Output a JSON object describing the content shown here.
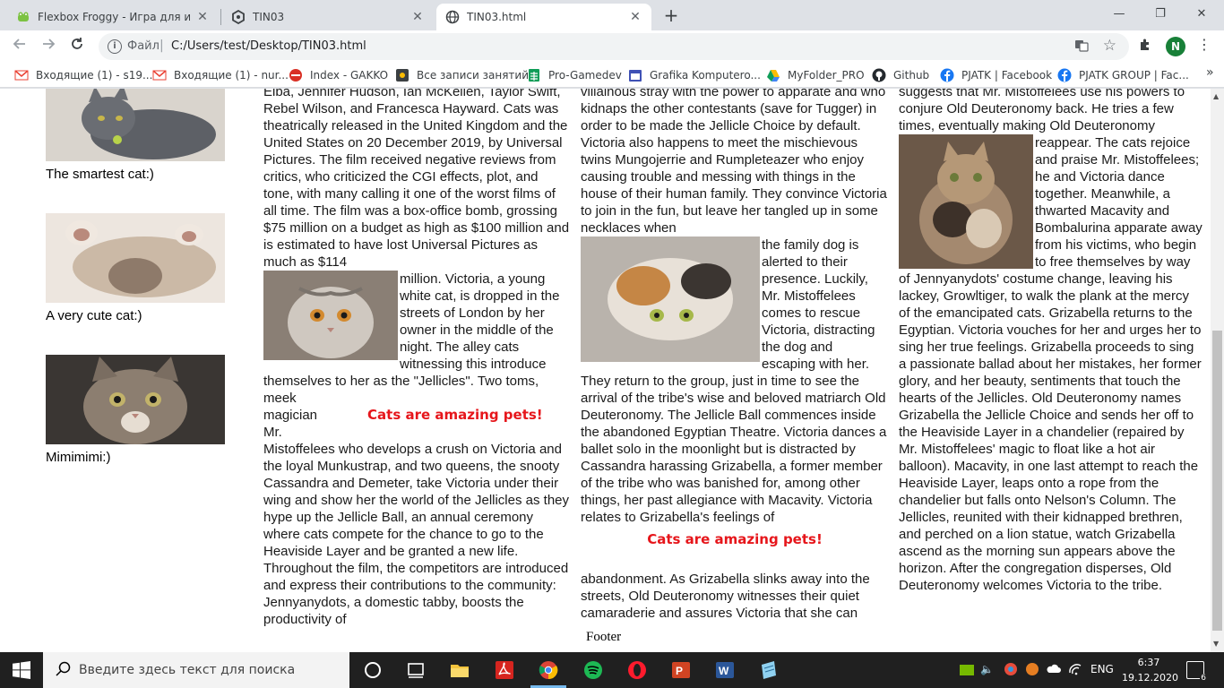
{
  "browser": {
    "tabs": [
      {
        "title": "Flexbox Froggy - Игра для изуче",
        "active": false
      },
      {
        "title": "TIN03",
        "active": false
      },
      {
        "title": "TIN03.html",
        "active": true
      }
    ],
    "omnibox": {
      "scheme_label": "Файл",
      "url": "C:/Users/test/Desktop/TIN03.html"
    },
    "profile_initial": "N",
    "bookmarks": [
      {
        "label": "Входящие (1) - s19...",
        "icon": "gmail-icon",
        "color": "#ea4335"
      },
      {
        "label": "Входящие (1) - nur...",
        "icon": "gmail-icon",
        "color": "#ea4335"
      },
      {
        "label": "Index - GAKKO",
        "icon": "gakko-icon",
        "color": "#d93025"
      },
      {
        "label": "Все записи занятий",
        "icon": "records-icon",
        "color": "#5f6368"
      },
      {
        "label": "Pro-Gamedev",
        "icon": "sheets-icon",
        "color": "#0f9d58"
      },
      {
        "label": "Grafika Komputero...",
        "icon": "calendar-icon",
        "color": "#3f51b5"
      },
      {
        "label": "MyFolder_PRO",
        "icon": "drive-icon",
        "color": "#fbbc04"
      },
      {
        "label": "Github",
        "icon": "github-icon",
        "color": "#24292e"
      },
      {
        "label": "PJATK | Facebook",
        "icon": "facebook-icon",
        "color": "#1877f2"
      },
      {
        "label": "PJATK GROUP | Fac...",
        "icon": "facebook-icon",
        "color": "#1877f2"
      }
    ]
  },
  "page": {
    "captions": [
      "The smartest cat:)",
      "A very cute cat:)",
      "Mimimimi:)"
    ],
    "pets_label": "Cats are amazing pets!",
    "footer": "Footer",
    "col1": {
      "p1": "Elba, Jennifer Hudson, Ian McKellen, Taylor Swift, Rebel Wilson, and Francesca Hayward. Cats was theatrically released in the United Kingdom and the United States on 20 December 2019, by Universal Pictures. The film received negative reviews from critics, who criticized the CGI effects, plot, and tone, with many calling it one of the worst films of all time. The film was a box-office bomb, grossing $75 million on a budget as high as $100 million and is estimated to have lost Universal Pictures as much as $114",
      "p2": "million. Victoria, a young white cat, is dropped in the streets of London by her owner in the middle of the night. The alley cats witnessing this introduce themselves to her as the \"Jellicles\". Two toms, meek",
      "p3a": "magician",
      "p3b": "Mr.",
      "p4": "Mistoffelees who develops a crush on Victoria and the loyal Munkustrap, and two queens, the snooty Cassandra and Demeter, take Victoria under their wing and show her the world of the Jellicles as they hype up the Jellicle Ball, an annual ceremony where cats compete for the chance to go to the Heaviside Layer and be granted a new life. Throughout the film, the competitors are introduced and express their contributions to the community: Jennyanydots, a domestic tabby, boosts the productivity of"
    },
    "col2": {
      "p1": "villainous stray with the power to apparate and who kidnaps the other contestants (save for Tugger) in order to be made the Jellicle Choice by default. Victoria also happens to meet the mischievous twins Mungojerrie and Rumpleteazer who enjoy causing trouble and messing with things in the house of their human family. They convince Victoria to join in the fun, but leave her tangled up in some necklaces when",
      "p2": "the family dog is alerted to their presence. Luckily, Mr. Mistoffelees comes to rescue Victoria, distracting the dog and escaping with her. They return to the group, just in time to see the arrival of the tribe's wise and beloved matriarch Old Deuteronomy. The Jellicle Ball commences inside the abandoned Egyptian Theatre. Victoria dances a ballet solo in the moonlight but is distracted by Cassandra harassing Grizabella, a former member of the tribe who was banished for, among other things, her past allegiance with Macavity. Victoria relates to Grizabella's feelings of",
      "p3": "abandonment. As Grizabella slinks away into the streets, Old Deuteronomy witnesses their quiet camaraderie and assures Victoria that she can"
    },
    "col3": {
      "p1": "suggests that Mr. Mistoffelees use his powers to conjure Old Deuteronomy back. He tries a few times, eventually making Old Deuteronomy",
      "p2": "reappear. The cats rejoice and praise Mr. Mistoffelees; he and Victoria dance together. Meanwhile, a thwarted Macavity and Bombalurina apparate away from his victims, who begin to free themselves by way of Jennyanydots' costume change, leaving his lackey, Growltiger, to walk the plank at the mercy of the emancipated cats. Grizabella returns to the Egyptian. Victoria vouches for her and urges her to sing her true feelings. Grizabella proceeds to sing a passionate ballad about her mistakes, her former glory, and her beauty, sentiments that touch the hearts of the Jellicles. Old Deuteronomy names Grizabella the Jellicle Choice and sends her off to the Heaviside Layer in a chandelier (repaired by Mr. Mistoffelees' magic to float like a hot air balloon). Macavity, in one last attempt to reach the Heaviside Layer, leaps onto a rope from the chandelier but falls onto Nelson's Column. The Jellicles, reunited with their kidnapped brethren, and perched on a lion statue, watch Grizabella ascend as the morning sun appears above the horizon. After the congregation disperses, Old Deuteronomy welcomes Victoria to the tribe."
    }
  },
  "taskbar": {
    "search_placeholder": "Введите здесь текст для поиска",
    "language": "ENG",
    "time": "6:37",
    "date": "19.12.2020",
    "notification_count": "6"
  }
}
